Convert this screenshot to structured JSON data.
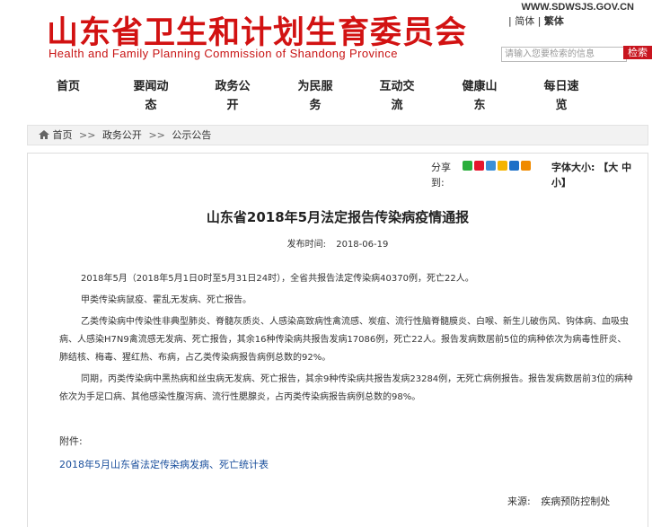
{
  "header": {
    "logo_cn": "山东省卫生和计划生育委员会",
    "logo_en": "Health and Family Planning Commission of Shandong Province",
    "site_url": "WWW.SDWSJS.GOV.CN",
    "lang_simplified": "简体",
    "lang_traditional": "繁体",
    "search_placeholder": "请输入您要检索的信息",
    "search_button": "检索",
    "brand_color": "#d21212"
  },
  "nav": {
    "items": [
      {
        "line1": "首页",
        "line2": ""
      },
      {
        "line1": "要闻动",
        "line2": "态"
      },
      {
        "line1": "政务公",
        "line2": "开"
      },
      {
        "line1": "为民服",
        "line2": "务"
      },
      {
        "line1": "互动交",
        "line2": "流"
      },
      {
        "line1": "健康山",
        "line2": "东"
      },
      {
        "line1": "每日速",
        "line2": "览"
      }
    ]
  },
  "breadcrumb": {
    "home": "首页",
    "item1": "政务公开",
    "item2": "公示公告",
    "sep": ">>"
  },
  "toolbar": {
    "share_label": "分享到:",
    "font_size_label": "字体大小:",
    "font_large": "【大",
    "font_medium": "中",
    "font_small": "小】",
    "share_icons": [
      "wechat-icon",
      "weibo-icon",
      "tencent-weibo-icon",
      "qzone-icon",
      "renren-icon",
      "more-icon"
    ]
  },
  "article": {
    "title": "山东省2018年5月法定报告传染病疫情通报",
    "date_label": "发布时间:",
    "date": "2018-06-19",
    "paragraphs": [
      "2018年5月（2018年5月1日0时至5月31日24时），全省共报告法定传染病40370例，死亡22人。",
      "甲类传染病鼠疫、霍乱无发病、死亡报告。",
      "乙类传染病中传染性非典型肺炎、脊髓灰质炎、人感染高致病性禽流感、炭疽、流行性脑脊髓膜炎、白喉、新生儿破伤风、钩体病、血吸虫病、人感染H7N9禽流感无发病、死亡报告，其余16种传染病共报告发病17086例，死亡22人。报告发病数居前5位的病种依次为病毒性肝炎、肺结核、梅毒、猩红热、布病，占乙类传染病报告病例总数的92%。",
      "同期，丙类传染病中黑热病和丝虫病无发病、死亡报告，其余9种传染病共报告发病23284例，无死亡病例报告。报告发病数居前3位的病种依次为手足口病、其他感染性腹泻病、流行性腮腺炎，占丙类传染病报告病例总数的98%。"
    ],
    "attachment_label": "附件:",
    "attachment_link": "2018年5月山东省法定传染病发病、死亡统计表",
    "source_label": "来源:",
    "source": "疾病预防控制处"
  }
}
